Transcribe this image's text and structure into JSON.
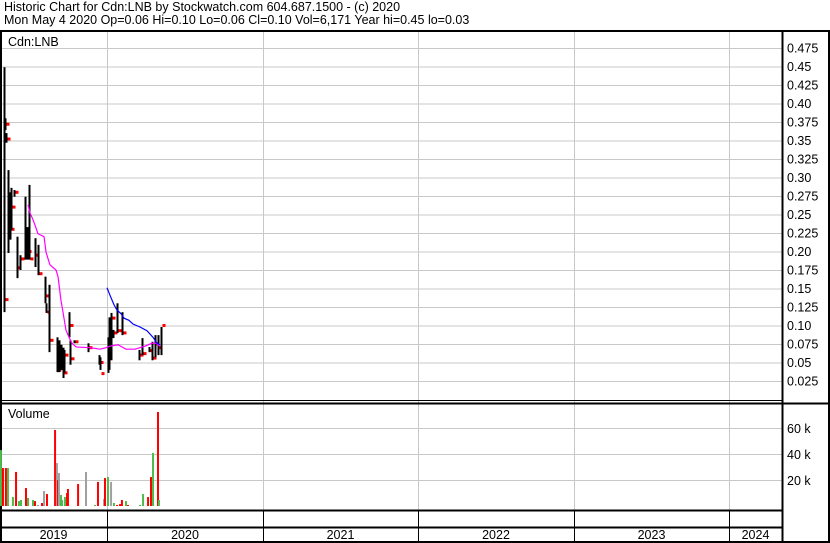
{
  "header": {
    "title": "Historic Chart for Cdn:LNB by Stockwatch.com 604.687.1500 - (c) 2020",
    "quote": "Mon May  4 2020  Op=0.06  Hi=0.10  Lo=0.06  Cl=0.10  Vol=6,171  Year hi=0.45  lo=0.03"
  },
  "colors": {
    "bar": "#000000",
    "close": "#ff0000",
    "ma_long": "#ff00ff",
    "ma_short": "#0000ff",
    "vol_up": "#ff0000",
    "vol_down": "#4cbb4c",
    "vol_flat": "#a0a0a0",
    "grid": "#c8c8c8"
  },
  "chart_data": [
    {
      "type": "ohlc",
      "title": "Cdn:LNB",
      "yticks": [
        "0.475",
        "0.45",
        "0.425",
        "0.40",
        "0.375",
        "0.35",
        "0.325",
        "0.30",
        "0.275",
        "0.25",
        "0.225",
        "0.20",
        "0.175",
        "0.15",
        "0.125",
        "0.10",
        "0.075",
        "0.05",
        "0.025"
      ],
      "ylim": [
        0.0,
        0.5
      ],
      "xlim": [
        2019.0,
        2024.34
      ],
      "bars": [
        [
          2019.338,
          0.449,
          0.118,
          0.135
        ],
        [
          2019.344,
          0.38,
          0.364,
          0.372
        ],
        [
          2019.35,
          0.36,
          0.347,
          0.352
        ],
        [
          2019.363,
          0.31,
          0.198,
          0.24
        ],
        [
          2019.376,
          0.28,
          0.216,
          0.23
        ],
        [
          2019.383,
          0.286,
          0.229,
          0.26
        ],
        [
          2019.402,
          0.283,
          0.274,
          0.28
        ],
        [
          2019.421,
          0.22,
          0.164,
          0.178
        ],
        [
          2019.441,
          0.195,
          0.175,
          0.19
        ],
        [
          2019.473,
          0.274,
          0.189,
          0.195
        ],
        [
          2019.486,
          0.233,
          0.189,
          0.2
        ],
        [
          2019.498,
          0.29,
          0.189,
          0.19
        ],
        [
          2019.537,
          0.218,
          0.179,
          0.195
        ],
        [
          2019.556,
          0.209,
          0.168,
          0.17
        ],
        [
          2019.601,
          0.166,
          0.13,
          0.14
        ],
        [
          2019.608,
          0.13,
          0.117,
          0.118
        ],
        [
          2019.627,
          0.155,
          0.064,
          0.08
        ],
        [
          2019.678,
          0.084,
          0.037,
          0.04
        ],
        [
          2019.691,
          0.08,
          0.037,
          0.06
        ],
        [
          2019.704,
          0.074,
          0.04,
          0.05
        ],
        [
          2019.717,
          0.07,
          0.029,
          0.036
        ],
        [
          2019.723,
          0.067,
          0.036,
          0.06
        ],
        [
          2019.756,
          0.118,
          0.084,
          0.1
        ],
        [
          2019.762,
          0.08,
          0.047,
          0.055
        ],
        [
          2019.788,
          0.08,
          0.076,
          0.078
        ],
        [
          2019.878,
          0.076,
          0.064,
          0.07
        ],
        [
          2019.949,
          0.06,
          0.047,
          0.05
        ],
        [
          2019.955,
          0.057,
          0.04,
          0.035
        ],
        [
          2020.006,
          0.084,
          0.036,
          0.06
        ],
        [
          2020.013,
          0.111,
          0.04,
          0.09
        ],
        [
          2020.026,
          0.117,
          0.053,
          0.11
        ],
        [
          2020.039,
          0.094,
          0.083,
          0.09
        ],
        [
          2020.064,
          0.13,
          0.09,
          0.093
        ],
        [
          2020.096,
          0.118,
          0.087,
          0.09
        ],
        [
          2020.206,
          0.067,
          0.053,
          0.06
        ],
        [
          2020.225,
          0.083,
          0.06,
          0.062
        ],
        [
          2020.27,
          0.071,
          0.064,
          0.066
        ],
        [
          2020.289,
          0.078,
          0.053,
          0.056
        ],
        [
          2020.309,
          0.087,
          0.057,
          0.075
        ],
        [
          2020.328,
          0.087,
          0.06,
          0.07
        ],
        [
          2020.347,
          0.098,
          0.06,
          0.1
        ]
      ],
      "ma_long": [
        [
          2019.492,
          0.263
        ],
        [
          2019.505,
          0.252
        ],
        [
          2019.524,
          0.243
        ],
        [
          2019.543,
          0.232
        ],
        [
          2019.556,
          0.224
        ],
        [
          2019.595,
          0.22
        ],
        [
          2019.608,
          0.199
        ],
        [
          2019.627,
          0.186
        ],
        [
          2019.633,
          0.182
        ],
        [
          2019.672,
          0.175
        ],
        [
          2019.685,
          0.166
        ],
        [
          2019.704,
          0.134
        ],
        [
          2019.717,
          0.118
        ],
        [
          2019.736,
          0.094
        ],
        [
          2019.756,
          0.084
        ],
        [
          2019.775,
          0.076
        ],
        [
          2019.801,
          0.071
        ],
        [
          2019.891,
          0.07
        ],
        [
          2019.955,
          0.068
        ],
        [
          2019.994,
          0.07
        ],
        [
          2020.019,
          0.072
        ],
        [
          2020.071,
          0.074
        ],
        [
          2020.122,
          0.068
        ],
        [
          2020.18,
          0.068
        ],
        [
          2020.244,
          0.072
        ],
        [
          2020.289,
          0.076
        ],
        [
          2020.315,
          0.076
        ],
        [
          2020.341,
          0.072
        ]
      ],
      "ma_short": [
        [
          2020.0,
          0.151
        ],
        [
          2020.019,
          0.141
        ],
        [
          2020.045,
          0.128
        ],
        [
          2020.064,
          0.121
        ],
        [
          2020.09,
          0.116
        ],
        [
          2020.109,
          0.11
        ],
        [
          2020.141,
          0.107
        ],
        [
          2020.167,
          0.102
        ],
        [
          2020.212,
          0.098
        ],
        [
          2020.257,
          0.093
        ],
        [
          2020.296,
          0.084
        ],
        [
          2020.322,
          0.076
        ],
        [
          2020.341,
          0.074
        ]
      ]
    },
    {
      "type": "bar",
      "title": "Volume",
      "yticks": [
        {
          "label": "60 k",
          "value": 60000
        },
        {
          "label": "40 k",
          "value": 40000
        },
        {
          "label": "20 k",
          "value": 20000
        }
      ],
      "ylim": [
        0,
        80000
      ],
      "bars": [
        [
          2019.318,
          43000,
          "down"
        ],
        [
          2019.331,
          29200,
          "up"
        ],
        [
          2019.35,
          29200,
          "up"
        ],
        [
          2019.363,
          29200,
          "down"
        ],
        [
          2019.395,
          6900,
          "down"
        ],
        [
          2019.415,
          26200,
          "up"
        ],
        [
          2019.434,
          3800,
          "down"
        ],
        [
          2019.447,
          4600,
          "down"
        ],
        [
          2019.479,
          13800,
          "up"
        ],
        [
          2019.492,
          6200,
          "down"
        ],
        [
          2019.524,
          4600,
          "down"
        ],
        [
          2019.537,
          3800,
          "up"
        ],
        [
          2019.556,
          800,
          "flat"
        ],
        [
          2019.582,
          2300,
          "up"
        ],
        [
          2019.595,
          11500,
          "flat"
        ],
        [
          2019.614,
          9200,
          "up"
        ],
        [
          2019.666,
          58500,
          "up"
        ],
        [
          2019.678,
          33000,
          "flat"
        ],
        [
          2019.685,
          20000,
          "up"
        ],
        [
          2019.691,
          25400,
          "flat"
        ],
        [
          2019.704,
          8500,
          "down"
        ],
        [
          2019.711,
          4600,
          "down"
        ],
        [
          2019.73,
          6900,
          "down"
        ],
        [
          2019.743,
          10000,
          "up"
        ],
        [
          2019.749,
          13100,
          "up"
        ],
        [
          2019.814,
          16900,
          "up"
        ],
        [
          2019.865,
          26200,
          "flat"
        ],
        [
          2019.923,
          800,
          "down"
        ],
        [
          2019.942,
          18500,
          "up"
        ],
        [
          2019.981,
          5400,
          "flat"
        ],
        [
          2019.987,
          21500,
          "up"
        ],
        [
          2020.006,
          22300,
          "down"
        ],
        [
          2020.026,
          18500,
          "flat"
        ],
        [
          2020.045,
          2300,
          "down"
        ],
        [
          2020.064,
          800,
          "up"
        ],
        [
          2020.084,
          1500,
          "up"
        ],
        [
          2020.096,
          4600,
          "up"
        ],
        [
          2020.122,
          3800,
          "down"
        ],
        [
          2020.135,
          800,
          "up"
        ],
        [
          2020.212,
          800,
          "down"
        ],
        [
          2020.232,
          9200,
          "down"
        ],
        [
          2020.264,
          6900,
          "up"
        ],
        [
          2020.283,
          22300,
          "up"
        ],
        [
          2020.296,
          40800,
          "down"
        ],
        [
          2020.328,
          72300,
          "up"
        ],
        [
          2020.334,
          4600,
          "down"
        ]
      ]
    }
  ],
  "x_axis": {
    "years": [
      "2019",
      "2020",
      "2021",
      "2022",
      "2023",
      "2024"
    ]
  }
}
